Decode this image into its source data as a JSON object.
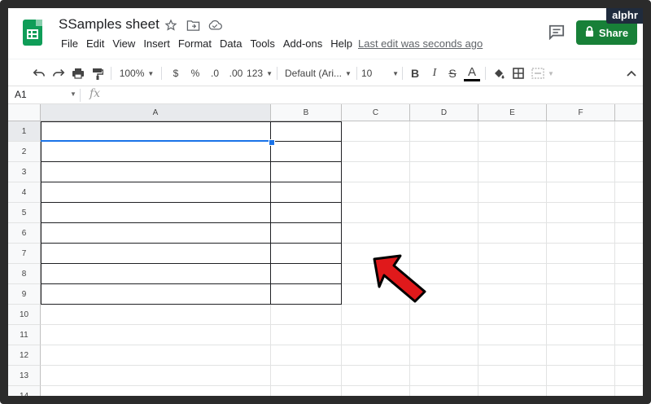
{
  "brand": "alphr",
  "document": {
    "title": "SSamples sheet"
  },
  "menu": [
    "File",
    "Edit",
    "View",
    "Insert",
    "Format",
    "Data",
    "Tools",
    "Add-ons",
    "Help"
  ],
  "last_edit": "Last edit was seconds ago",
  "share_label": "Share",
  "toolbar": {
    "zoom": "100%",
    "currency": "$",
    "percent": "%",
    "decrease_decimals": ".0",
    "increase_decimals": ".00",
    "more_formats": "123",
    "font": "Default (Ari...",
    "font_size": "10",
    "bold": "B",
    "italic": "I",
    "strikethrough": "S",
    "text_color": "A"
  },
  "formula_bar": {
    "cell_ref": "A1",
    "fx": "fx"
  },
  "grid": {
    "columns": [
      "A",
      "B",
      "C",
      "D",
      "E",
      "F"
    ],
    "rows": [
      "1",
      "2",
      "3",
      "4",
      "5",
      "6",
      "7",
      "8",
      "9",
      "10",
      "11",
      "12",
      "13",
      "14"
    ]
  },
  "colors": {
    "sheets_green": "#0f9d58",
    "share_green": "#188038",
    "selection_blue": "#1a73e8",
    "arrow_red": "#e0191b"
  }
}
